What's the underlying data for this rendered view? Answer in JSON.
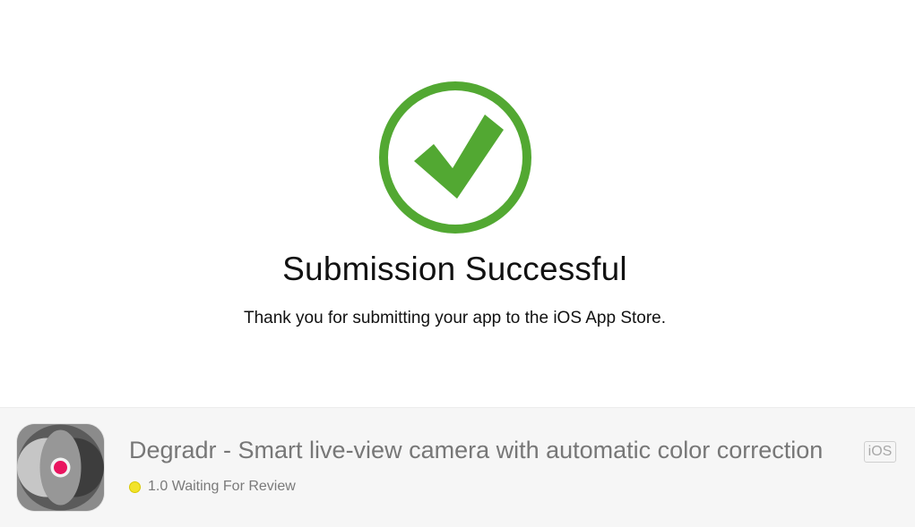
{
  "confirmation": {
    "title": "Submission Successful",
    "message": "Thank you for submitting your app to the iOS App Store.",
    "icon": "checkmark-circle-icon",
    "accent_color": "#52a832"
  },
  "app": {
    "name": "Degradr - Smart live-view camera with automatic color correction",
    "platform": "iOS",
    "icon": "degradr-app-icon",
    "status": {
      "version_status": "1.0 Waiting For Review",
      "dot_color": "#f2e32a"
    }
  }
}
